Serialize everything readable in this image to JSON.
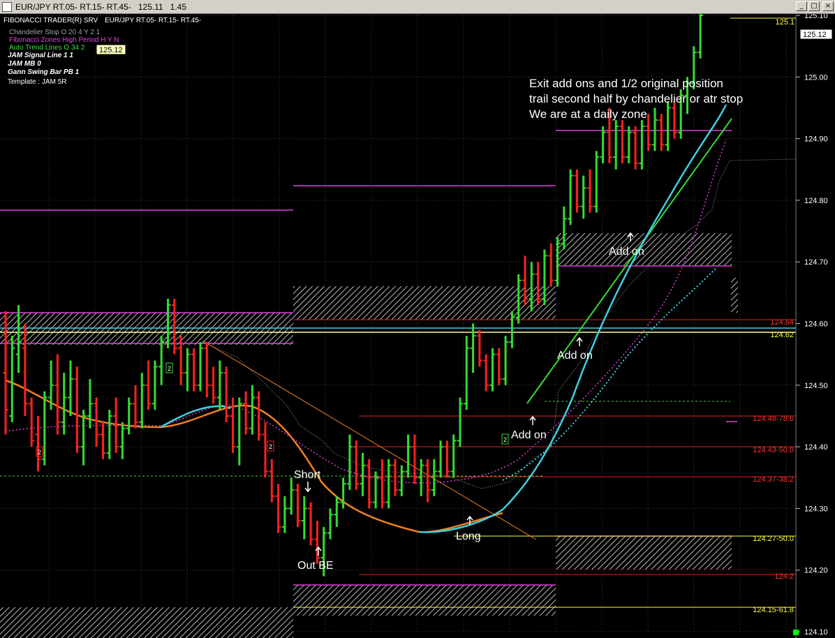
{
  "window": {
    "title": "EUR/JPY RT.05- RT.15- RT.45-   125.11   1.45",
    "subtitle_left": "FIBONACCI TRADER(R) SRV",
    "subtitle_symbol": "EUR/JPY RT.05- RT.15- RT.45-",
    "buttons": {
      "minimize": "_",
      "restore": "□",
      "close": "×"
    }
  },
  "indicators": [
    {
      "text": "Chandelier Stop O 20 4 Y 2 1",
      "color": "#a0a0a0",
      "bold": false
    },
    {
      "text": "Fibonacci Zones High Period H Y N",
      "color": "#e040e0",
      "bold": false
    },
    {
      "text": "Auto Trend Lines O 34 2",
      "color": "#40e040",
      "bold": false
    },
    {
      "text": "JAM Signal Line 1 1",
      "color": "#ffffff",
      "bold": true
    },
    {
      "text": "JAM MB 0",
      "color": "#ffffff",
      "bold": true
    },
    {
      "text": "Gann Swing Bar PB 1",
      "color": "#ffffff",
      "bold": true
    },
    {
      "text": "Template : JAM 5R",
      "color": "#ffffff",
      "bold": false
    }
  ],
  "price_tooltip": "125.12",
  "current_price_label": "125.12",
  "top_right_label": "125.1",
  "annotations": {
    "exit_lines": [
      "Exit add ons and 1/2 original position",
      "trail second half by chandelier or atr stop",
      "We are at a daily zone"
    ],
    "short": "Short",
    "out_be": "Out BE",
    "long": "Long",
    "add_on_1": "Add on",
    "add_on_2": "Add on",
    "add_on_3": "Add on",
    "signal_marker": "2"
  },
  "colors": {
    "up_bar": "#33dd33",
    "down_bar": "#ff2020",
    "signal_line": "#40d0e0",
    "ma_line": "#f08020",
    "zone": "#e040e0",
    "fib_line": "#e02020",
    "grid": "#404040"
  },
  "chart_data": {
    "type": "bar",
    "y_axis": {
      "min": 124.1,
      "max": 125.15,
      "ticks": [
        "125.10",
        "125.00",
        "124.90",
        "124.80",
        "124.70",
        "124.60",
        "124.50",
        "124.40",
        "124.30",
        "124.20",
        "124.10"
      ]
    },
    "level_labels": [
      {
        "text": "124.64",
        "price": 124.64,
        "color": "#ff3030"
      },
      {
        "text": "124.62",
        "price": 124.62,
        "color": "#ffff40"
      },
      {
        "text": "124.48-78.6",
        "price": 124.475,
        "color": "#ff3030"
      },
      {
        "text": "124.43-50.0",
        "price": 124.43,
        "color": "#ff3030"
      },
      {
        "text": "124.37-38.2",
        "price": 124.37,
        "color": "#ff3030"
      },
      {
        "text": "124.27-50.0",
        "price": 124.27,
        "color": "#ffff40"
      },
      {
        "text": "124.2",
        "price": 124.2,
        "color": "#ff3030"
      },
      {
        "text": "124.15-61.8",
        "price": 124.15,
        "color": "#ffff40"
      }
    ],
    "bars": [
      [
        124.52,
        124.62,
        124.42,
        124.46
      ],
      [
        124.45,
        124.58,
        124.44,
        124.56
      ],
      [
        124.55,
        124.63,
        124.52,
        124.57
      ],
      [
        124.56,
        124.6,
        124.45,
        124.47
      ],
      [
        124.47,
        124.48,
        124.4,
        124.41
      ],
      [
        124.42,
        124.45,
        124.36,
        124.38
      ],
      [
        124.38,
        124.49,
        124.37,
        124.48
      ],
      [
        124.48,
        124.54,
        124.46,
        124.5
      ],
      [
        124.5,
        124.55,
        124.42,
        124.44
      ],
      [
        124.44,
        124.52,
        124.42,
        124.48
      ],
      [
        124.48,
        124.54,
        124.45,
        124.51
      ],
      [
        124.51,
        124.53,
        124.39,
        124.4
      ],
      [
        124.4,
        124.46,
        124.37,
        124.45
      ],
      [
        124.45,
        124.51,
        124.43,
        124.47
      ],
      [
        124.47,
        124.48,
        124.4,
        124.42
      ],
      [
        124.42,
        124.44,
        124.38,
        124.39
      ],
      [
        124.39,
        124.46,
        124.38,
        124.45
      ],
      [
        124.45,
        124.48,
        124.39,
        124.4
      ],
      [
        124.4,
        124.44,
        124.38,
        124.43
      ],
      [
        124.43,
        124.48,
        124.42,
        124.47
      ],
      [
        124.47,
        124.5,
        124.43,
        124.44
      ],
      [
        124.44,
        124.52,
        124.43,
        124.5
      ],
      [
        124.5,
        124.54,
        124.46,
        124.47
      ],
      [
        124.47,
        124.54,
        124.46,
        124.53
      ],
      [
        124.53,
        124.58,
        124.5,
        124.57
      ],
      [
        124.57,
        124.64,
        124.56,
        124.63
      ],
      [
        124.63,
        124.64,
        124.55,
        124.56
      ],
      [
        124.56,
        124.58,
        124.5,
        124.52
      ],
      [
        124.52,
        124.56,
        124.49,
        124.55
      ],
      [
        124.55,
        124.56,
        124.49,
        124.5
      ],
      [
        124.5,
        124.57,
        124.49,
        124.56
      ],
      [
        124.56,
        124.57,
        124.48,
        124.5
      ],
      [
        124.5,
        124.53,
        124.47,
        124.48
      ],
      [
        124.48,
        124.54,
        124.46,
        124.52
      ],
      [
        124.52,
        124.53,
        124.44,
        124.45
      ],
      [
        124.45,
        124.48,
        124.39,
        124.4
      ],
      [
        124.4,
        124.48,
        124.37,
        124.47
      ],
      [
        124.47,
        124.49,
        124.42,
        124.43
      ],
      [
        124.43,
        124.5,
        124.42,
        124.48
      ],
      [
        124.48,
        124.49,
        124.41,
        124.42
      ],
      [
        124.42,
        124.44,
        124.35,
        124.36
      ],
      [
        124.36,
        124.38,
        124.31,
        124.32
      ],
      [
        124.32,
        124.34,
        124.26,
        124.27
      ],
      [
        124.27,
        124.32,
        124.26,
        124.3
      ],
      [
        124.3,
        124.35,
        124.29,
        124.33
      ],
      [
        124.33,
        124.34,
        124.27,
        124.28
      ],
      [
        124.28,
        124.32,
        124.25,
        124.3
      ],
      [
        124.3,
        124.31,
        124.24,
        124.25
      ],
      [
        124.25,
        124.28,
        124.21,
        124.22
      ],
      [
        124.22,
        124.27,
        124.19,
        124.26
      ],
      [
        124.26,
        124.3,
        124.25,
        124.29
      ],
      [
        124.29,
        124.32,
        124.27,
        124.31
      ],
      [
        124.31,
        124.35,
        124.3,
        124.34
      ],
      [
        124.34,
        124.42,
        124.33,
        124.4
      ],
      [
        124.4,
        124.41,
        124.33,
        124.34
      ],
      [
        124.34,
        124.39,
        124.32,
        124.37
      ],
      [
        124.37,
        124.38,
        124.3,
        124.31
      ],
      [
        124.31,
        124.36,
        124.3,
        124.35
      ],
      [
        124.35,
        124.38,
        124.3,
        124.31
      ],
      [
        124.31,
        124.38,
        124.3,
        124.37
      ],
      [
        124.37,
        124.38,
        124.32,
        124.33
      ],
      [
        124.33,
        124.37,
        124.32,
        124.36
      ],
      [
        124.36,
        124.42,
        124.35,
        124.4
      ],
      [
        124.4,
        124.42,
        124.34,
        124.35
      ],
      [
        124.35,
        124.38,
        124.32,
        124.37
      ],
      [
        124.37,
        124.38,
        124.31,
        124.33
      ],
      [
        124.33,
        124.38,
        124.32,
        124.36
      ],
      [
        124.36,
        124.41,
        124.35,
        124.4
      ],
      [
        124.4,
        124.41,
        124.35,
        124.36
      ],
      [
        124.36,
        124.42,
        124.35,
        124.41
      ],
      [
        124.41,
        124.48,
        124.4,
        124.47
      ],
      [
        124.47,
        124.58,
        124.46,
        124.56
      ],
      [
        124.56,
        124.6,
        124.52,
        124.58
      ],
      [
        124.58,
        124.59,
        124.53,
        124.54
      ],
      [
        124.54,
        124.55,
        124.49,
        124.5
      ],
      [
        124.5,
        124.56,
        124.49,
        124.55
      ],
      [
        124.55,
        124.56,
        124.5,
        124.51
      ],
      [
        124.51,
        124.58,
        124.5,
        124.57
      ],
      [
        124.57,
        124.62,
        124.56,
        124.61
      ],
      [
        124.61,
        124.68,
        124.6,
        124.67
      ],
      [
        124.67,
        124.71,
        124.63,
        124.64
      ],
      [
        124.64,
        124.7,
        124.62,
        124.68
      ],
      [
        124.68,
        124.7,
        124.63,
        124.64
      ],
      [
        124.64,
        124.72,
        124.63,
        124.71
      ],
      [
        124.71,
        124.73,
        124.66,
        124.67
      ],
      [
        124.67,
        124.74,
        124.66,
        124.73
      ],
      [
        124.73,
        124.79,
        124.72,
        124.77
      ],
      [
        124.77,
        124.85,
        124.76,
        124.84
      ],
      [
        124.84,
        124.85,
        124.78,
        124.79
      ],
      [
        124.79,
        124.84,
        124.77,
        124.82
      ],
      [
        124.82,
        124.85,
        124.78,
        124.79
      ],
      [
        124.79,
        124.88,
        124.78,
        124.87
      ],
      [
        124.87,
        124.92,
        124.86,
        124.91
      ],
      [
        124.91,
        124.95,
        124.86,
        124.87
      ],
      [
        124.87,
        124.93,
        124.85,
        124.92
      ],
      [
        124.92,
        124.93,
        124.86,
        124.87
      ],
      [
        124.87,
        124.92,
        124.86,
        124.91
      ],
      [
        124.91,
        124.92,
        124.85,
        124.86
      ],
      [
        124.86,
        124.93,
        124.85,
        124.92
      ],
      [
        124.92,
        124.94,
        124.88,
        124.89
      ],
      [
        124.89,
        124.95,
        124.88,
        124.93
      ],
      [
        124.93,
        124.94,
        124.88,
        124.89
      ],
      [
        124.89,
        124.96,
        124.88,
        124.95
      ],
      [
        124.95,
        124.96,
        124.9,
        124.91
      ],
      [
        124.91,
        124.98,
        124.9,
        124.97
      ],
      [
        124.97,
        125.0,
        124.94,
        124.99
      ],
      [
        124.99,
        125.05,
        124.98,
        125.04
      ],
      [
        125.04,
        125.11,
        125.03,
        125.1
      ]
    ]
  }
}
